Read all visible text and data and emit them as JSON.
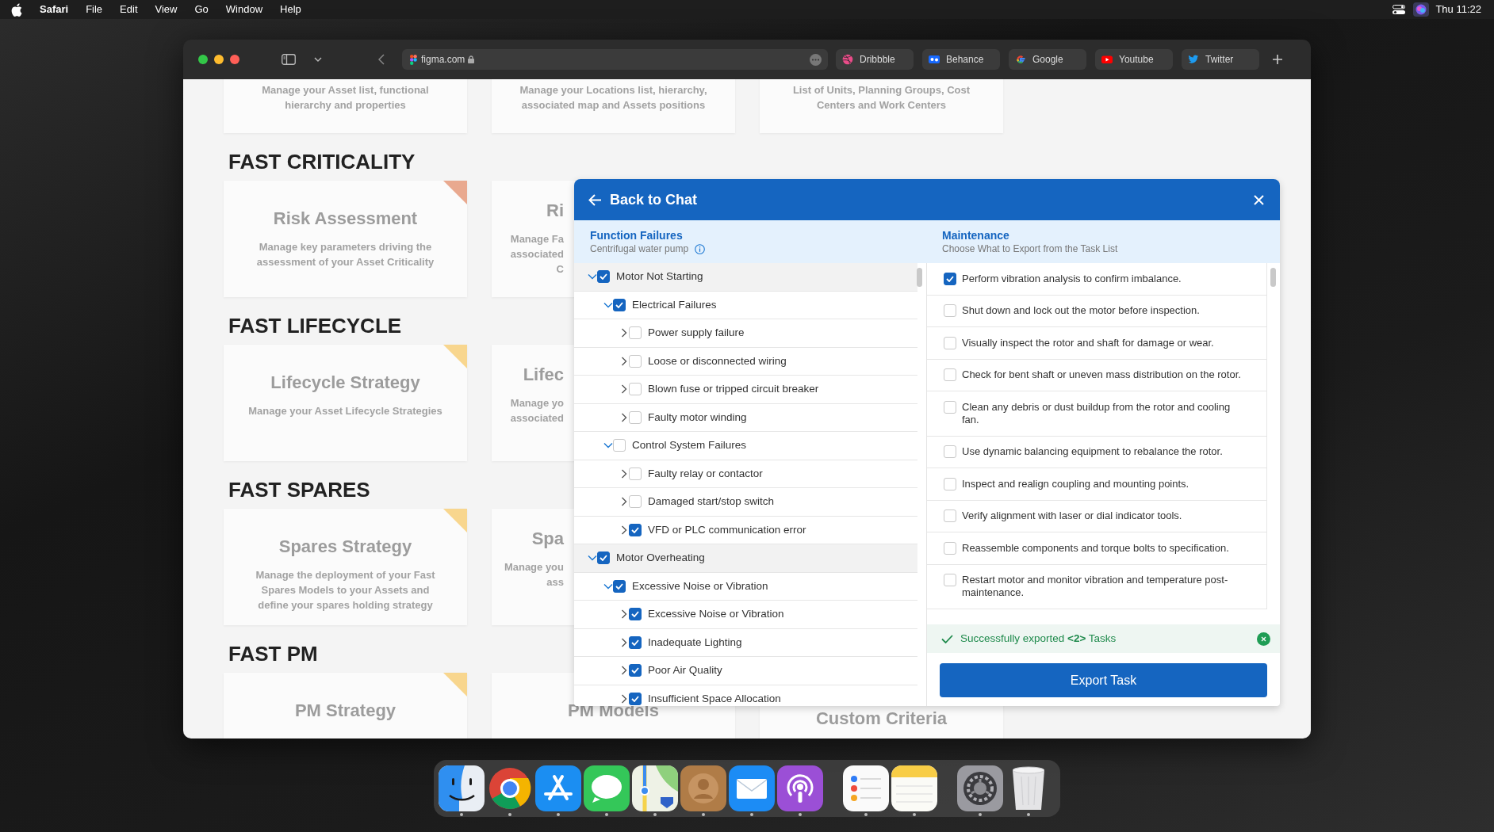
{
  "menu_bar": {
    "app": "Safari",
    "menus": [
      "File",
      "Edit",
      "View",
      "Go",
      "Window",
      "Help"
    ],
    "clock": "Thu 11:22"
  },
  "browser": {
    "address": "figma.com",
    "favorites": [
      {
        "label": "Dribbble",
        "kind": "dribbble"
      },
      {
        "label": "Behance",
        "kind": "behance"
      },
      {
        "label": "Google",
        "kind": "google"
      },
      {
        "label": "Youtube",
        "kind": "youtube"
      },
      {
        "label": "Twitter",
        "kind": "twitter"
      }
    ]
  },
  "page": {
    "top_cards": [
      {
        "description": [
          "Manage your Asset list, functional",
          "hierarchy and properties"
        ]
      },
      {
        "description": [
          "Manage your Locations list, hierarchy,",
          "associated map and Assets positions"
        ]
      },
      {
        "description": [
          "List of Units, Planning Groups, Cost",
          "Centers and Work Centers"
        ]
      }
    ],
    "sections": [
      {
        "heading": "FAST CRITICALITY",
        "cards": [
          {
            "title": "Risk Assessment",
            "description": [
              "Manage key parameters driving the",
              "assessment of your Asset Criticality"
            ],
            "color": "#e9a98f"
          },
          {
            "title": "Ri",
            "description": [
              "Manage Fa",
              "associated",
              "C"
            ]
          }
        ]
      },
      {
        "heading": "FAST LIFECYCLE",
        "cards": [
          {
            "title": "Lifecycle Strategy",
            "description": [
              "Manage your Asset Lifecycle Strategies"
            ],
            "color": "#f8d68e"
          },
          {
            "title": "Lifec",
            "description": [
              "Manage yo",
              "associated"
            ]
          }
        ]
      },
      {
        "heading": "FAST SPARES",
        "cards": [
          {
            "title": "Spares Strategy",
            "description": [
              "Manage the deployment of your Fast",
              "Spares Models to your Assets and",
              "define your spares holding strategy"
            ],
            "color": "#f8d68e"
          },
          {
            "title": "Spa",
            "description": [
              "Manage you",
              "ass"
            ]
          }
        ]
      },
      {
        "heading": "FAST PM",
        "cards": [
          {
            "title": "PM Strategy",
            "color": "#f8d68e"
          },
          {
            "title": "PM Models"
          },
          {
            "title": "Custom Criteria"
          }
        ]
      }
    ]
  },
  "modal": {
    "back_label": "Back to Chat",
    "left": {
      "title": "Function Failures",
      "subtitle": "Centrifugal water pump",
      "tree": [
        {
          "label": "Motor Not Starting",
          "checked": true,
          "expanded": true,
          "children": [
            {
              "label": "Electrical Failures",
              "checked": true,
              "expanded": true,
              "children": [
                {
                  "label": "Power supply failure",
                  "checked": false,
                  "expanded": false
                },
                {
                  "label": "Loose or disconnected wiring",
                  "checked": false,
                  "expanded": false
                },
                {
                  "label": "Blown fuse or tripped circuit breaker",
                  "checked": false,
                  "expanded": false
                },
                {
                  "label": "Faulty motor winding",
                  "checked": false,
                  "expanded": false
                }
              ]
            },
            {
              "label": "Control System Failures",
              "checked": false,
              "expanded": true,
              "children": [
                {
                  "label": "Faulty relay or contactor",
                  "checked": false,
                  "expanded": false
                },
                {
                  "label": "Damaged start/stop switch",
                  "checked": false,
                  "expanded": false
                },
                {
                  "label": "VFD or PLC communication error",
                  "checked": true,
                  "expanded": false
                }
              ]
            }
          ]
        },
        {
          "label": "Motor Overheating",
          "checked": true,
          "expanded": true,
          "children": [
            {
              "label": "Excessive Noise or Vibration",
              "checked": true,
              "expanded": true,
              "children": [
                {
                  "label": "Excessive Noise or Vibration",
                  "checked": true,
                  "expanded": false
                },
                {
                  "label": "Inadequate Lighting",
                  "checked": true,
                  "expanded": false
                },
                {
                  "label": "Poor Air Quality",
                  "checked": true,
                  "expanded": false
                },
                {
                  "label": "Insufficient Space Allocation",
                  "checked": true,
                  "expanded": false
                }
              ]
            }
          ]
        }
      ]
    },
    "right": {
      "title": "Maintenance",
      "subtitle": "Choose What to Export from the Task List",
      "tasks": [
        {
          "label": "Perform vibration analysis to confirm imbalance.",
          "checked": true
        },
        {
          "label": "Shut down and lock out the motor before inspection.",
          "checked": false
        },
        {
          "label": "Visually inspect the rotor and shaft for damage or wear.",
          "checked": false
        },
        {
          "label": "Check for bent shaft or uneven mass distribution on the rotor.",
          "checked": false
        },
        {
          "label": "Clean any debris or dust buildup from the rotor and cooling fan.",
          "checked": false
        },
        {
          "label": "Use dynamic balancing equipment to rebalance the rotor.",
          "checked": false
        },
        {
          "label": "Inspect and realign coupling and mounting points.",
          "checked": false
        },
        {
          "label": "Verify alignment with laser or dial indicator tools.",
          "checked": false
        },
        {
          "label": "Reassemble components and torque bolts to specification.",
          "checked": false
        },
        {
          "label": "Restart motor and monitor vibration and temperature post-maintenance.",
          "checked": false
        }
      ]
    },
    "toast": {
      "message": "Successfully exported **<2>** Tasks"
    },
    "export_label": "Export Task"
  },
  "dock": [
    {
      "apps": [
        {
          "kind": "finder",
          "running": true
        },
        {
          "kind": "chrome",
          "running": true
        },
        {
          "kind": "appstore",
          "running": true
        },
        {
          "kind": "messages",
          "running": true
        },
        {
          "kind": "maps",
          "running": true
        },
        {
          "kind": "contacts",
          "running": true
        },
        {
          "kind": "mail",
          "running": true
        },
        {
          "kind": "podcasts",
          "running": true
        }
      ]
    },
    {
      "apps": [
        {
          "kind": "reminders",
          "running": true
        },
        {
          "kind": "notes",
          "running": true
        }
      ]
    },
    {
      "apps": [
        {
          "kind": "settings",
          "running": true
        },
        {
          "kind": "trash",
          "running": true
        }
      ]
    }
  ]
}
